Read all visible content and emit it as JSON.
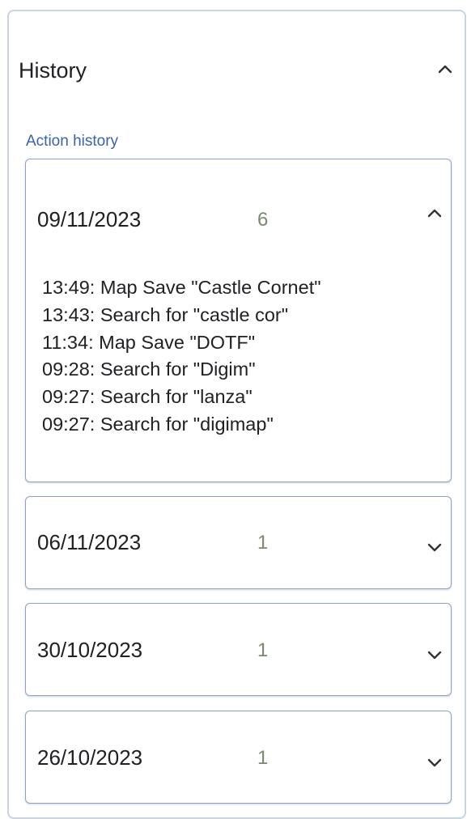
{
  "panel": {
    "title": "History",
    "expanded": true,
    "icon": "chevron-up-icon"
  },
  "section_label": "Action history",
  "days": [
    {
      "date": "09/11/2023",
      "count": "6",
      "expanded": true,
      "icon": "chevron-up-icon",
      "entries": [
        "13:49: Map Save \"Castle Cornet\"",
        "13:43: Search for \"castle cor\"",
        "11:34: Map Save \"DOTF\"",
        "09:28: Search for \"Digim\"",
        "09:27: Search for \"lanza\"",
        "09:27: Search for \"digimap\""
      ]
    },
    {
      "date": "06/11/2023",
      "count": "1",
      "expanded": false,
      "icon": "chevron-down-icon"
    },
    {
      "date": "30/10/2023",
      "count": "1",
      "expanded": false,
      "icon": "chevron-down-icon"
    },
    {
      "date": "26/10/2023",
      "count": "1",
      "expanded": false,
      "icon": "chevron-down-icon"
    }
  ],
  "colors": {
    "panel_border": "#c9d3e4",
    "card_border": "#8fa4c3",
    "section_label": "#3a63a8",
    "count": "#7b8a6f",
    "text": "#202124"
  }
}
